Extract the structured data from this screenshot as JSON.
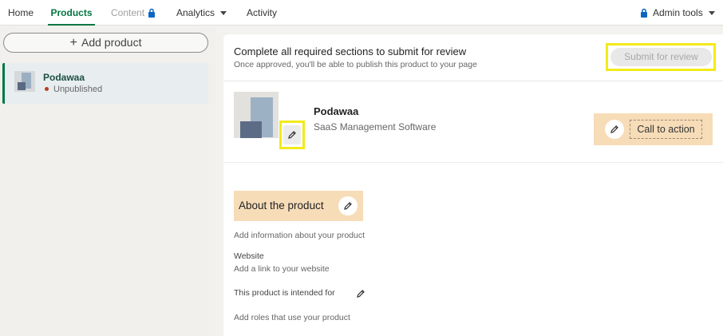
{
  "nav": {
    "home": "Home",
    "products": "Products",
    "content": "Content",
    "analytics": "Analytics",
    "activity": "Activity",
    "admin": "Admin tools"
  },
  "sidebar": {
    "add_product": "Add product",
    "product": {
      "name": "Podawaa",
      "status": "Unpublished"
    }
  },
  "banner": {
    "title": "Complete all required sections to submit for review",
    "subtitle": "Once approved, you'll be able to publish this product to your page",
    "submit": "Submit for review"
  },
  "product": {
    "name": "Podawaa",
    "category": "SaaS Management Software",
    "cta": "Call to action"
  },
  "about": {
    "title": "About the product",
    "description_placeholder": "Add information about your product",
    "website_label": "Website",
    "website_placeholder": "Add a link to your website",
    "intended_label": "This product is intended for",
    "roles_placeholder": "Add roles that use your product"
  },
  "colors": {
    "brand_green": "#057642",
    "highlight_yellow": "#f3ea1a",
    "highlight_orange": "#f7dcb8",
    "status_unpublished": "#b24020"
  },
  "icons": [
    "lock-icon",
    "chevron-down-icon",
    "plus-icon",
    "pencil-icon"
  ]
}
